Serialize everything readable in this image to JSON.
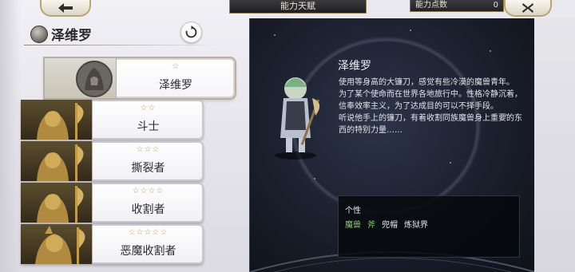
{
  "header": {
    "title": "能力天赋",
    "points_label": "能力点数",
    "points_value": "0"
  },
  "icons": {
    "back": "back-arrow-icon",
    "close": "close-x-icon",
    "refresh": "refresh-icon",
    "emblem": "character-emblem-icon"
  },
  "character": {
    "name": "泽维罗"
  },
  "jobs": [
    {
      "stars": "☆",
      "name": "泽维罗",
      "selected": true,
      "locked": false
    },
    {
      "stars": "☆☆",
      "name": "斗士",
      "selected": false,
      "locked": true
    },
    {
      "stars": "☆☆☆",
      "name": "撕裂者",
      "selected": false,
      "locked": true
    },
    {
      "stars": "☆☆☆☆",
      "name": "收割者",
      "selected": false,
      "locked": true
    },
    {
      "stars": "☆☆☆☆☆",
      "name": "恶魔收割者",
      "selected": false,
      "locked": true
    }
  ],
  "detail": {
    "name": "泽维罗",
    "lines": [
      "使用等身高的大镰刀，感觉有些冷漠的魔兽青年。",
      "为了某个使命而在世界各地旅行中。性格冷静沉着，信奉效率主义，为了达成目的可以不择手段。",
      "听说他手上的镰刀，有着收割同族魔兽身上重要的东西的特别力量……"
    ],
    "trait_title": "个性",
    "traits": [
      {
        "label": "魔兽",
        "highlight": true
      },
      {
        "label": "斧",
        "highlight": true
      },
      {
        "label": "兜帽",
        "highlight": false
      },
      {
        "label": "炼狱界",
        "highlight": false
      }
    ]
  },
  "colors": {
    "star": "#d19a3a",
    "trait_highlight": "#7fd66b",
    "panel_bg": "#1a1f2c",
    "gold_border": "#b7a670"
  }
}
